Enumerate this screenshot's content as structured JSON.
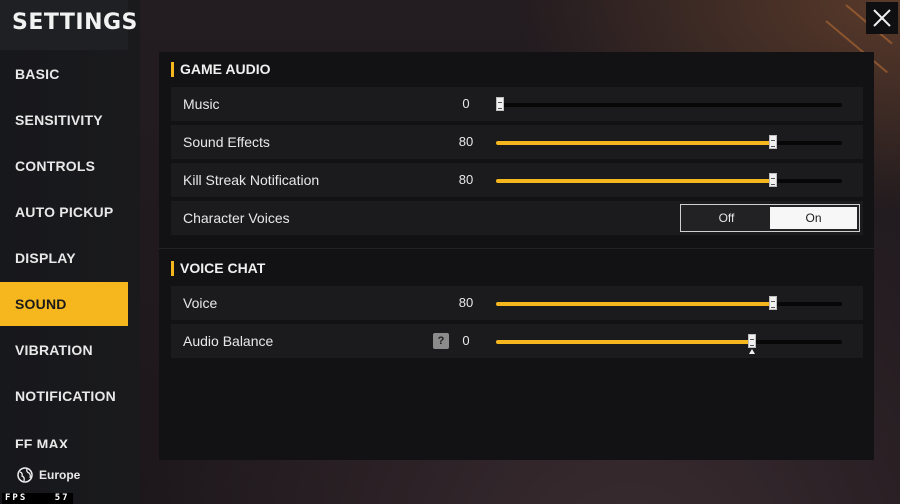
{
  "sidebar": {
    "title": "SETTINGS",
    "items": [
      {
        "label": "BASIC",
        "active": false
      },
      {
        "label": "SENSITIVITY",
        "active": false
      },
      {
        "label": "CONTROLS",
        "active": false
      },
      {
        "label": "AUTO PICKUP",
        "active": false
      },
      {
        "label": "DISPLAY",
        "active": false
      },
      {
        "label": "SOUND",
        "active": true
      },
      {
        "label": "VIBRATION",
        "active": false
      },
      {
        "label": "NOTIFICATION",
        "active": false
      },
      {
        "label": "FF MAX",
        "active": false
      }
    ],
    "region": "Europe",
    "fps_label": "FPS",
    "fps_value": "57"
  },
  "close_icon": "close-x-icon",
  "sections": [
    {
      "title": "GAME AUDIO",
      "rows": [
        {
          "label": "Music",
          "type": "slider",
          "value": "0",
          "fraction": 0.0
        },
        {
          "label": "Sound Effects",
          "type": "slider",
          "value": "80",
          "fraction": 0.8
        },
        {
          "label": "Kill Streak Notification",
          "type": "slider",
          "value": "80",
          "fraction": 0.8
        },
        {
          "label": "Character Voices",
          "type": "toggle",
          "off_label": "Off",
          "on_label": "On",
          "selected": "On"
        }
      ]
    },
    {
      "title": "VOICE CHAT",
      "rows": [
        {
          "label": "Voice",
          "type": "slider",
          "value": "80",
          "fraction": 0.8
        },
        {
          "label": "Audio Balance",
          "type": "balance",
          "value": "0",
          "fraction": 0.74,
          "help_icon": "question-mark-icon"
        }
      ]
    }
  ],
  "colors": {
    "accent": "#f6b71e",
    "panel": "#121214",
    "row": "#1b1b1e"
  }
}
